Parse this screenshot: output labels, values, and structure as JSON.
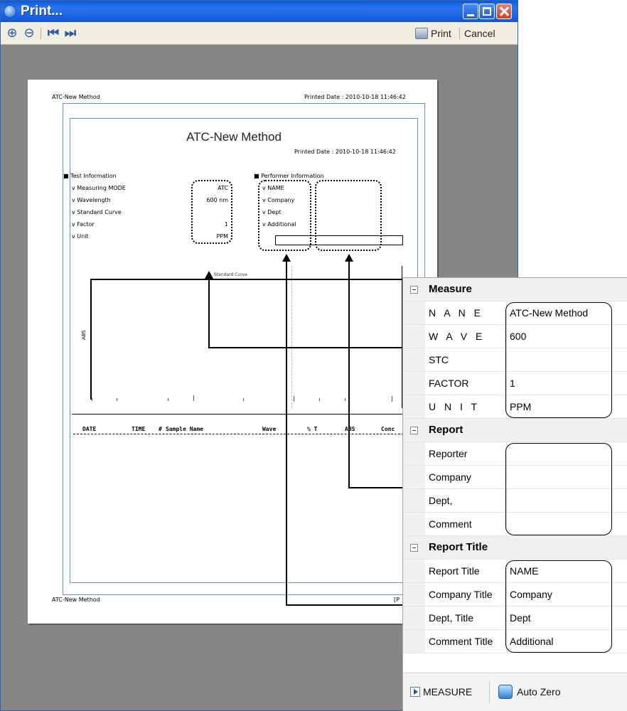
{
  "window": {
    "title": "Print..."
  },
  "toolbar": {
    "zoom_in_icon": "zoom-in-icon",
    "zoom_out_icon": "zoom-out-icon",
    "first_icon": "first-page-icon",
    "next_icon": "next-page-icon",
    "print_label": "Print",
    "cancel_label": "Cancel"
  },
  "paper": {
    "header_left": "ATC-New Method",
    "header_right": "Printed Date : 2010-10-18  11:46:42",
    "title": "ATC-New Method",
    "printed_date": "Printed Date : 2010-10-18  11:46:42",
    "test_info_heading": "■  Test Information",
    "test_labels": [
      "v  Measuring MODE",
      "v  Wavelength",
      "v  Standard Curve",
      "v  Factor",
      "v  Unit"
    ],
    "test_values": [
      "ATC",
      "600 nm",
      "",
      "1",
      "PPM"
    ],
    "performer_heading": "■  Performer Information",
    "performer_labels": [
      "v  NAME",
      "v  Company",
      "v  Dept",
      "v  Additional"
    ],
    "chart_title": "Standard Curve",
    "y_axis_label": "ABS",
    "table_headers": [
      "DATE",
      "TIME",
      "#",
      "Sample Name",
      "Wave",
      "% T",
      "ABS",
      "Conc"
    ],
    "footer_left": "ATC-New Method",
    "footer_right": "[P"
  },
  "panel": {
    "measure": {
      "heading": "Measure",
      "rows": [
        {
          "name": "N A N E",
          "value": "ATC-New Method"
        },
        {
          "name": "W A V E",
          "value": "600"
        },
        {
          "name": "STC",
          "value": ""
        },
        {
          "name": "FACTOR",
          "value": "1"
        },
        {
          "name": "U N I T",
          "value": "PPM"
        }
      ]
    },
    "report": {
      "heading": "Report",
      "rows": [
        {
          "name": "Reporter",
          "value": ""
        },
        {
          "name": "Company",
          "value": ""
        },
        {
          "name": "Dept,",
          "value": ""
        },
        {
          "name": "Comment",
          "value": ""
        }
      ]
    },
    "report_title": {
      "heading": "Report Title",
      "rows": [
        {
          "name": "Report Title",
          "value": "NAME"
        },
        {
          "name": "Company Title",
          "value": "Company"
        },
        {
          "name": "Dept, Title",
          "value": "Dept"
        },
        {
          "name": "Comment Title",
          "value": "Additional"
        }
      ]
    },
    "measure_button": "MEASURE",
    "auto_zero_button": "Auto Zero"
  },
  "colors": {
    "titlebar": "#1157d4",
    "close": "#c4452a",
    "background": "#858585",
    "frame": "#6a8fd0"
  }
}
